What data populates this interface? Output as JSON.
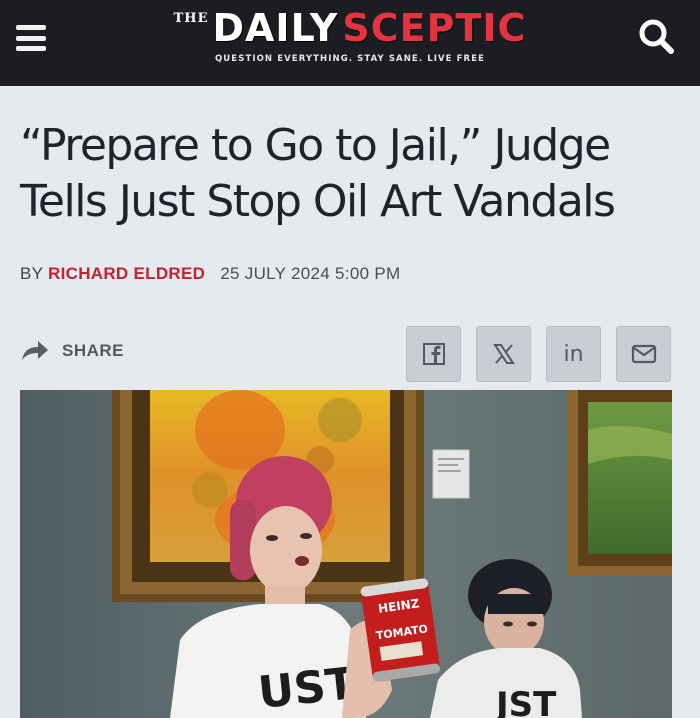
{
  "header": {
    "logo_the": "THE",
    "logo_daily": "DAILY",
    "logo_sceptic": "SCEPTIC",
    "tagline": "QUESTION EVERYTHING. STAY SANE. LIVE FREE"
  },
  "article": {
    "title": "“Prepare to Go to Jail,” Judge Tells Just Stop Oil Art Vandals",
    "by_label": "BY",
    "author": "RICHARD ELDRED",
    "date": "25 JULY 2024 5:00 PM"
  },
  "share": {
    "label": "SHARE",
    "buttons": [
      {
        "name": "facebook-share-button",
        "icon": "facebook-icon"
      },
      {
        "name": "x-share-button",
        "icon": "x-icon"
      },
      {
        "name": "linkedin-share-button",
        "icon": "linkedin-icon",
        "text": "in"
      },
      {
        "name": "email-share-button",
        "icon": "email-icon"
      }
    ]
  },
  "photo": {
    "can_label_1": "HEINZ",
    "can_label_2": "TOMATO",
    "shirt_left": "UST",
    "shirt_right": "JST"
  },
  "colors": {
    "header_bg": "#1b1d22",
    "accent_red": "#e3343f",
    "author_red": "#c4222f",
    "page_bg": "#e6e9ee"
  }
}
